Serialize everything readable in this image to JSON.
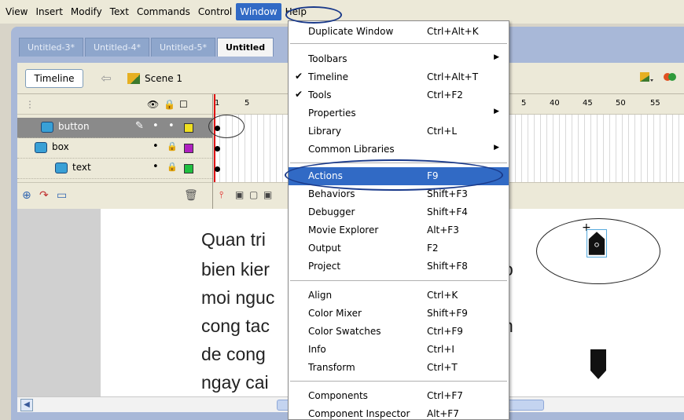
{
  "menubar": {
    "items": [
      "View",
      "Insert",
      "Modify",
      "Text",
      "Commands",
      "Control",
      "Window",
      "Help"
    ]
  },
  "tabs": [
    "Untitled-3*",
    "Untitled-4*",
    "Untitled-5*",
    "Untitled"
  ],
  "toolbar": {
    "timeline_label": "Timeline",
    "scene_label": "Scene 1"
  },
  "timeline": {
    "layers": [
      {
        "name": "button",
        "selected": true
      },
      {
        "name": "box",
        "selected": false
      },
      {
        "name": "text",
        "selected": false
      }
    ],
    "ruler_numbers": [
      "1",
      "5",
      "5",
      "40",
      "45",
      "50",
      "55"
    ]
  },
  "stage": {
    "lines": [
      "Quan tri",
      "bien kier",
      "moi nguc",
      "cong tac",
      "de cong",
      "ngay cai"
    ],
    "right_fragments": [
      "o",
      "n"
    ]
  },
  "window_menu": {
    "items": [
      {
        "label": "Duplicate Window",
        "shortcut": "Ctrl+Alt+K"
      },
      {
        "label": "Toolbars",
        "shortcut": ""
      },
      {
        "label": "Timeline",
        "shortcut": "Ctrl+Alt+T"
      },
      {
        "label": "Tools",
        "shortcut": "Ctrl+F2"
      },
      {
        "label": "Properties",
        "shortcut": ""
      },
      {
        "label": "Library",
        "shortcut": "Ctrl+L"
      },
      {
        "label": "Common Libraries",
        "shortcut": ""
      },
      {
        "label": "Actions",
        "shortcut": "F9"
      },
      {
        "label": "Behaviors",
        "shortcut": "Shift+F3"
      },
      {
        "label": "Debugger",
        "shortcut": "Shift+F4"
      },
      {
        "label": "Movie Explorer",
        "shortcut": "Alt+F3"
      },
      {
        "label": "Output",
        "shortcut": "F2"
      },
      {
        "label": "Project",
        "shortcut": "Shift+F8"
      },
      {
        "label": "Align",
        "shortcut": "Ctrl+K"
      },
      {
        "label": "Color Mixer",
        "shortcut": "Shift+F9"
      },
      {
        "label": "Color Swatches",
        "shortcut": "Ctrl+F9"
      },
      {
        "label": "Info",
        "shortcut": "Ctrl+I"
      },
      {
        "label": "Transform",
        "shortcut": "Ctrl+T"
      },
      {
        "label": "Components",
        "shortcut": "Ctrl+F7"
      },
      {
        "label": "Component Inspector",
        "shortcut": "Alt+F7"
      }
    ]
  },
  "colors": {
    "highlight": "#316ac5",
    "annotation": "#1a3a8a",
    "layer_icon": "#39a0d6"
  }
}
